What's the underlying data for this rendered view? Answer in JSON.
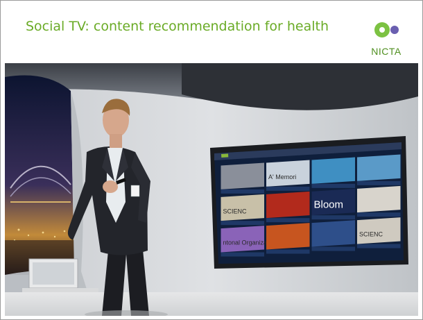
{
  "slide": {
    "title": "Social TV: content recommendation for health"
  },
  "logo": {
    "text": "NICTA",
    "colors": {
      "green": "#7cc242",
      "purple": "#6a5fb0",
      "text": "#4f8f1f"
    }
  },
  "photo": {
    "description_icon": "presenter-photo",
    "tv_tiles": [
      {
        "caption": "",
        "color": "#8a8f9a"
      },
      {
        "caption": "A' Memori",
        "color": "#c9d2dc"
      },
      {
        "caption": "",
        "color": "#3f8fc2"
      },
      {
        "caption": "",
        "color": "#5a9ac8"
      },
      {
        "caption": "SCIENC",
        "color": "#c8c0a8"
      },
      {
        "caption": "",
        "color": "#b22a1c"
      },
      {
        "caption": "Bloom",
        "color": "#1a2a55"
      },
      {
        "caption": "",
        "color": "#d8d4cc"
      },
      {
        "caption": "ntonal Organiza",
        "color": "#8a63b8"
      },
      {
        "caption": "",
        "color": "#c7551f"
      },
      {
        "caption": "",
        "color": "#2e4f8a"
      },
      {
        "caption": "SCIENC",
        "color": "#cfcac0"
      }
    ]
  }
}
